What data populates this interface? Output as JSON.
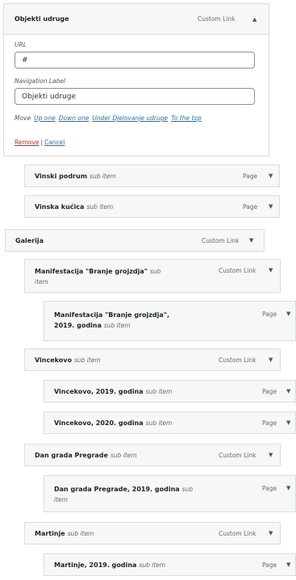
{
  "expanded": {
    "title": "Objekti udruge",
    "type": "Custom Link",
    "url_label": "URL",
    "url_value": "#",
    "nav_label": "Navigation Label",
    "nav_value": "Objekti udruge",
    "move_label": "Move",
    "move_links": [
      "Up one",
      "Down one",
      "Under Djelovanje udruge",
      "To the top"
    ],
    "remove": "Remove",
    "separator": "|",
    "cancel": "Cancel",
    "arrow": "▲"
  },
  "items": [
    {
      "title": "Vinski podrum",
      "sub": "sub item",
      "type": "Page"
    },
    {
      "title": "Vinska kućica",
      "sub": "sub item",
      "type": "Page"
    },
    {
      "title": "Galerija",
      "sub": "",
      "type": "Custom Link"
    },
    {
      "title": "Manifestacija \"Branje grojzdja\"",
      "sub": "sub item",
      "type": "Custom Link"
    },
    {
      "title": "Manifestacija \"Branje grojzdja\", 2019. godina",
      "sub": "sub item",
      "type": "Page"
    },
    {
      "title": "Vincekovo",
      "sub": "sub item",
      "type": "Custom Link"
    },
    {
      "title": "Vincekovo, 2019. godina",
      "sub": "sub item",
      "type": "Page"
    },
    {
      "title": "Vincekovo, 2020. godina",
      "sub": "sub item",
      "type": "Page"
    },
    {
      "title": "Dan grada Pregrade",
      "sub": "sub item",
      "type": "Custom Link"
    },
    {
      "title": "Dan grada Pregrade, 2019. godina",
      "sub": "sub item",
      "type": "Page"
    },
    {
      "title": "Martinje",
      "sub": "sub item",
      "type": "Custom Link"
    },
    {
      "title": "Martinje, 2019. godina",
      "sub": "sub item",
      "type": "Page"
    }
  ],
  "arrow_down": "▼"
}
